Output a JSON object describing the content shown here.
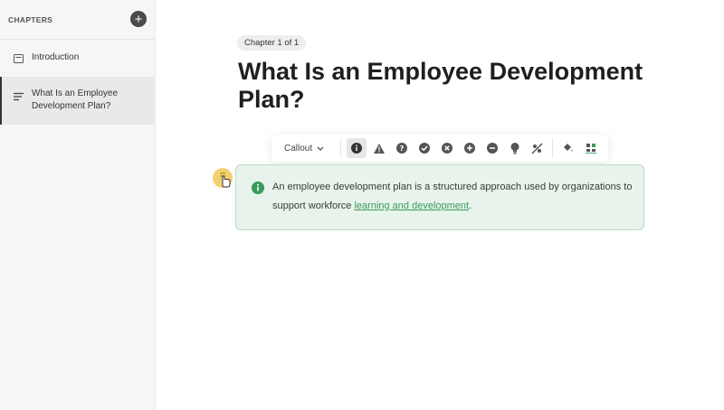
{
  "sidebar": {
    "title": "CHAPTERS",
    "add_label": "+",
    "items": [
      {
        "label": "Introduction",
        "icon": "page-icon"
      },
      {
        "label": "What Is an Employee Development Plan?",
        "icon": "text-lines-icon"
      }
    ]
  },
  "main": {
    "chapter_badge": "Chapter 1 of 1",
    "title": "What Is an Employee Development Plan?"
  },
  "toolbar": {
    "block_type": "Callout",
    "icons": [
      "info-icon",
      "warning-icon",
      "question-icon",
      "check-icon",
      "x-icon",
      "plus-icon",
      "minus-icon",
      "bulb-icon",
      "no-icon-icon",
      "paint-bucket-icon",
      "layout-icon"
    ]
  },
  "callout": {
    "text_before": "An employee development plan is a structured approach used by organizations to support workforce ",
    "link_text": "learning and development",
    "text_after": "."
  },
  "colors": {
    "accent_green": "#3a9a5c",
    "callout_bg": "#e7f3eb",
    "drag_handle": "#f3cf72"
  }
}
